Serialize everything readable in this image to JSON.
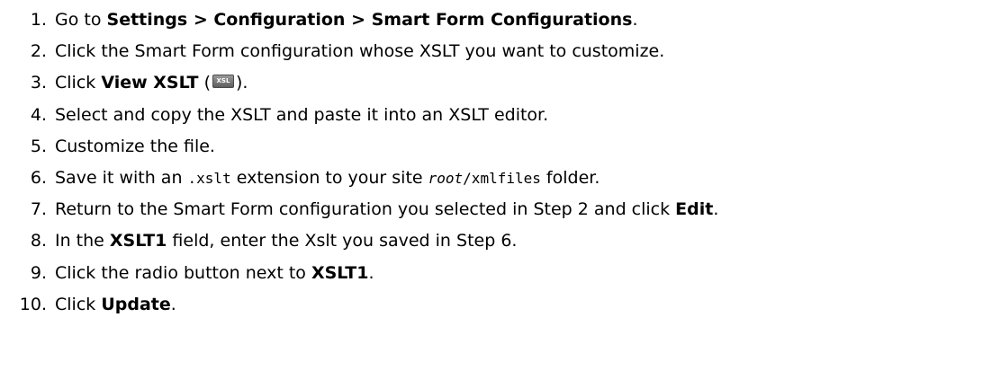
{
  "steps": [
    {
      "num": "1.",
      "parts": {
        "a": "Go to ",
        "b": "Settings > Configuration > Smart Form Configurations",
        "c": "."
      }
    },
    {
      "num": "2.",
      "parts": {
        "a": "Click the Smart Form configuration whose XSLT you want to customize."
      }
    },
    {
      "num": "3.",
      "parts": {
        "a": "Click ",
        "b": "View XSLT",
        "c": " (",
        "icon": "XSL",
        "d": ")."
      }
    },
    {
      "num": "4.",
      "parts": {
        "a": "Select and copy the XSLT and paste it into an XSLT editor."
      }
    },
    {
      "num": "5.",
      "parts": {
        "a": "Customize the file."
      }
    },
    {
      "num": "6.",
      "parts": {
        "a": "Save it with an ",
        "code1": ".xslt",
        "b": " extension to your site ",
        "code2_italic": "root",
        "code2": "/xmlfiles",
        "c": " folder."
      }
    },
    {
      "num": "7.",
      "parts": {
        "a": "Return to the Smart Form configuration you selected in Step 2 and click ",
        "b": "Edit",
        "c": "."
      }
    },
    {
      "num": "8.",
      "parts": {
        "a": "In the ",
        "b": "XSLT1",
        "c": " field, enter the Xslt you saved in Step 6."
      }
    },
    {
      "num": "9.",
      "parts": {
        "a": "Click the radio button next to ",
        "b": "XSLT1",
        "c": "."
      }
    },
    {
      "num": "10.",
      "parts": {
        "a": "Click ",
        "b": "Update",
        "c": "."
      }
    }
  ]
}
